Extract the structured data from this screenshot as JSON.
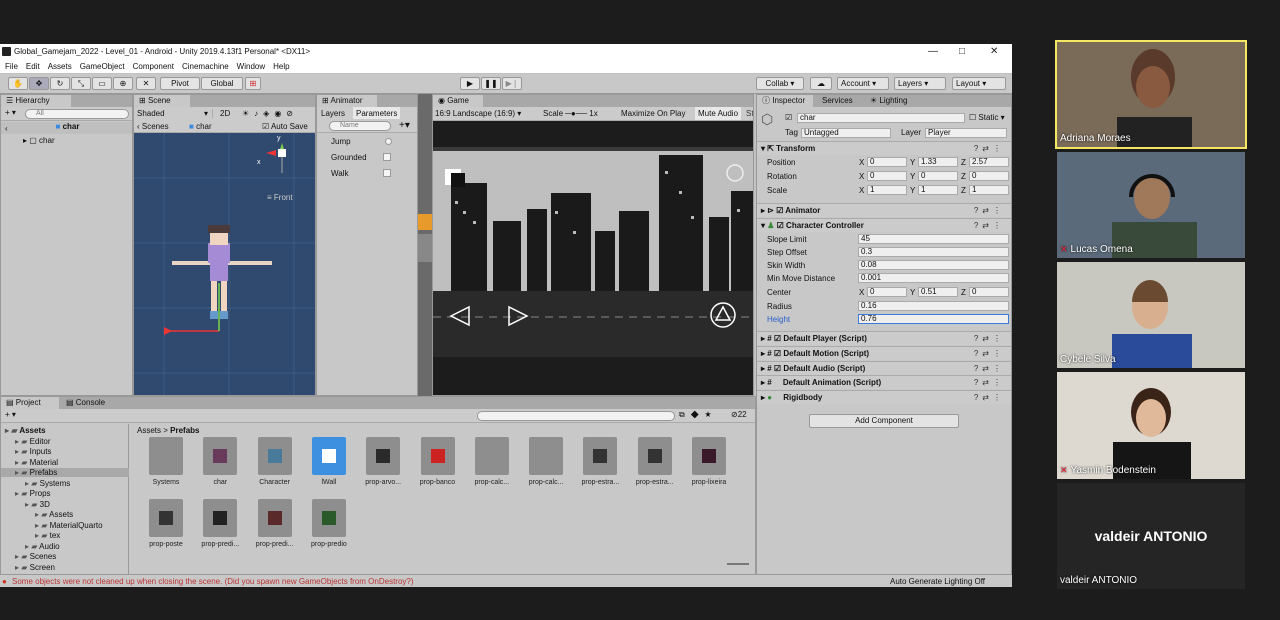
{
  "window": {
    "title": "Global_Gamejam_2022 - Level_01 - Android - Unity 2019.4.13f1 Personal* <DX11>",
    "minimize": "—",
    "maximize": "□",
    "close": "✕"
  },
  "menu": [
    "File",
    "Edit",
    "Assets",
    "GameObject",
    "Component",
    "Cinemachine",
    "Window",
    "Help"
  ],
  "toolbar": {
    "pivot": "Pivot",
    "global": "Global",
    "collab": "Collab ▾",
    "account": "Account",
    "layers": "Layers",
    "layout": "Layout"
  },
  "hierarchy": {
    "tab": "Hierarchy",
    "search": "All",
    "scene": "char",
    "root": "char"
  },
  "scene": {
    "tab": "Scene",
    "shading": "Shaded",
    "mode": "2D",
    "breadcrumb_scenes": "Scenes",
    "breadcrumb_obj": "char",
    "autosave": "Auto Save",
    "front": "Front",
    "gizmo_x": "x",
    "gizmo_y": "y"
  },
  "animator": {
    "tab": "Animator",
    "layers": "Layers",
    "parameters": "Parameters",
    "search": "Name",
    "params": [
      {
        "name": "Jump",
        "type": "trigger"
      },
      {
        "name": "Grounded",
        "type": "bool"
      },
      {
        "name": "Walk",
        "type": "bool"
      }
    ]
  },
  "game": {
    "tab": "Game",
    "display": "16:9 Landscape (16:9)",
    "scale_label": "Scale",
    "scale": "1x",
    "maximize": "Maximize On Play",
    "mute": "Mute Audio",
    "clip_left": "Ba",
    "clip_right": "St"
  },
  "inspector": {
    "tab": "Inspector",
    "services": "Services",
    "lighting": "Lighting",
    "object_name": "char",
    "static": "Static",
    "tag_label": "Tag",
    "tag": "Untagged",
    "layer_label": "Layer",
    "layer": "Player",
    "transform": {
      "title": "Transform",
      "position_label": "Position",
      "rotation_label": "Rotation",
      "scale_label": "Scale",
      "position": [
        "0",
        "1.33",
        "2.57"
      ],
      "rotation": [
        "0",
        "0",
        "0"
      ],
      "scale": [
        "1",
        "1",
        "1"
      ]
    },
    "animator_title": "Animator",
    "cc": {
      "title": "Character Controller",
      "slope_label": "Slope Limit",
      "slope": "45",
      "step_label": "Step Offset",
      "step": "0.3",
      "skin_label": "Skin Width",
      "skin": "0.08",
      "minmove_label": "Min Move Distance",
      "minmove": "0.001",
      "center_label": "Center",
      "center": [
        "0",
        "0.51",
        "0"
      ],
      "radius_label": "Radius",
      "radius": "0.16",
      "height_label": "Height",
      "height": "0.76"
    },
    "components": [
      "Default Player (Script)",
      "Default Motion (Script)",
      "Default Audio (Script)",
      "Default Animation (Script)",
      "Rigidbody"
    ],
    "add_component": "Add Component"
  },
  "project": {
    "tab": "Project",
    "console": "Console",
    "breadcrumb_root": "Assets",
    "breadcrumb_current": "Prefabs",
    "count": "22",
    "tree": [
      {
        "label": "Assets",
        "level": 0,
        "bold": true
      },
      {
        "label": "Editor",
        "level": 1
      },
      {
        "label": "Inputs",
        "level": 1
      },
      {
        "label": "Material",
        "level": 1
      },
      {
        "label": "Prefabs",
        "level": 1,
        "selected": true
      },
      {
        "label": "Systems",
        "level": 2
      },
      {
        "label": "Props",
        "level": 1
      },
      {
        "label": "3D",
        "level": 2
      },
      {
        "label": "Assets",
        "level": 3
      },
      {
        "label": "MaterialQuarto",
        "level": 3
      },
      {
        "label": "tex",
        "level": 3
      },
      {
        "label": "Audio",
        "level": 2
      },
      {
        "label": "Scenes",
        "level": 1
      },
      {
        "label": "Screen",
        "level": 1
      }
    ],
    "assets": [
      "Systems",
      "char",
      "Character",
      "lWall",
      "prop-arvo...",
      "prop-banco",
      "prop-calc...",
      "prop-calc...",
      "prop-estra...",
      "prop-estra...",
      "prop-lixeira",
      "prop-poste",
      "prop-predi...",
      "prop-predi...",
      "prop-predio"
    ]
  },
  "status": {
    "message": "Some objects were not cleaned up when closing the scene. (Did you spawn new GameObjects from OnDestroy?)",
    "lighting": "Auto Generate Lighting Off"
  },
  "participants": [
    "Adriana Moraes",
    "Lucas Omena",
    "Cybele Silva",
    "Yasmin Bodenstein",
    "valdeir ANTONIO"
  ],
  "participant_big": "valdeir ANTONIO",
  "colors": {
    "highlight": "#f5e663",
    "scene_bg": "#2f4a6e",
    "selected": "#3d7bd9"
  }
}
